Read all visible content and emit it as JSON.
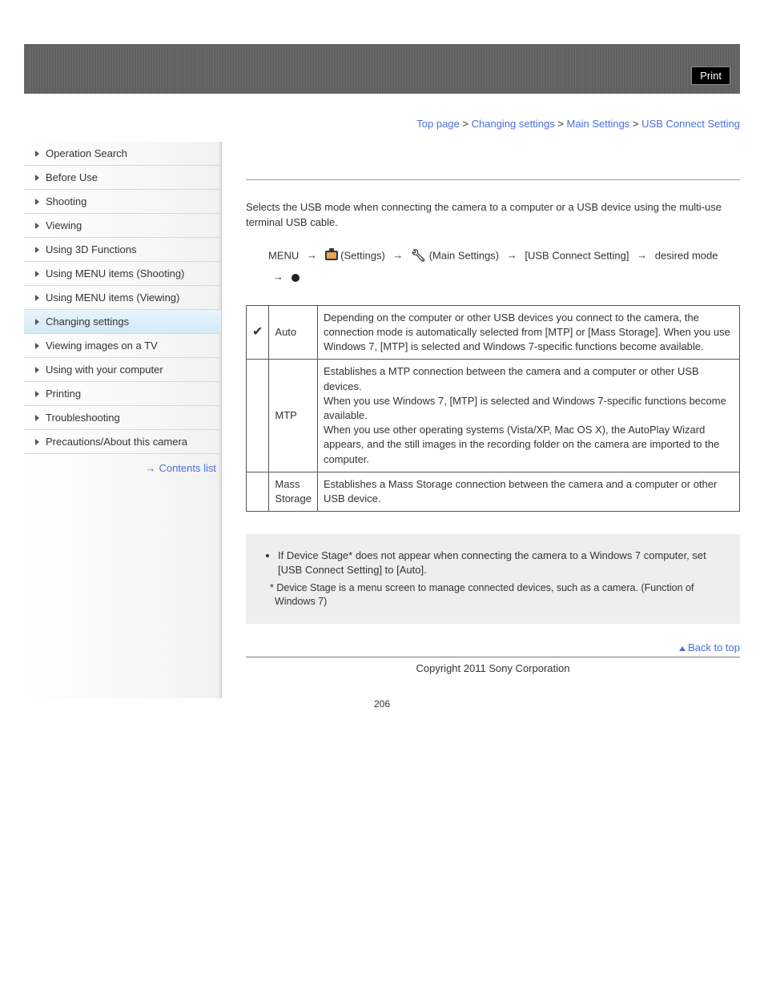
{
  "header": {
    "print": "Print"
  },
  "breadcrumb": {
    "top": "Top page",
    "sep": ">",
    "lvl1": "Changing settings",
    "lvl2": "Main Settings",
    "current": "USB Connect Setting"
  },
  "sidebar": {
    "items": [
      "Operation Search",
      "Before Use",
      "Shooting",
      "Viewing",
      "Using 3D Functions",
      "Using MENU items (Shooting)",
      "Using MENU items (Viewing)",
      "Changing settings",
      "Viewing images on a TV",
      "Using with your computer",
      "Printing",
      "Troubleshooting",
      "Precautions/About this camera"
    ],
    "active_index": 7,
    "contents_link": "Contents list"
  },
  "content": {
    "intro": "Selects the USB mode when connecting the camera to a computer or a USB device using the multi-use terminal USB cable.",
    "menu_path": {
      "menu": "MENU",
      "settings": "(Settings)",
      "main_settings": "(Main Settings)",
      "usb": "[USB Connect Setting]",
      "desired": "desired mode"
    },
    "table": [
      {
        "check": true,
        "label": "Auto",
        "desc": "Depending on the computer or other USB devices you connect to the camera, the connection mode is automatically selected from [MTP] or [Mass Storage]. When you use Windows 7, [MTP] is selected and Windows 7-specific functions become available."
      },
      {
        "check": false,
        "label": "MTP",
        "desc": "Establishes a MTP connection between the camera and a computer or other USB devices.\nWhen you use Windows 7, [MTP] is selected and Windows 7-specific functions become available.\nWhen you use other operating systems (Vista/XP, Mac OS X), the AutoPlay Wizard appears, and the still images in the recording folder on the camera are imported to the computer."
      },
      {
        "check": false,
        "label": "Mass Storage",
        "desc": "Establishes a Mass Storage connection between the camera and a computer or other USB device."
      }
    ],
    "notes": {
      "bullet": "If Device Stage* does not appear when connecting the camera to a Windows 7 computer, set [USB Connect Setting] to [Auto].",
      "footnote": "* Device Stage is a menu screen to manage connected devices, such as a camera. (Function of Windows 7)"
    },
    "back_to_top": "Back to top",
    "copyright": "Copyright 2011 Sony Corporation",
    "page_number": "206"
  }
}
